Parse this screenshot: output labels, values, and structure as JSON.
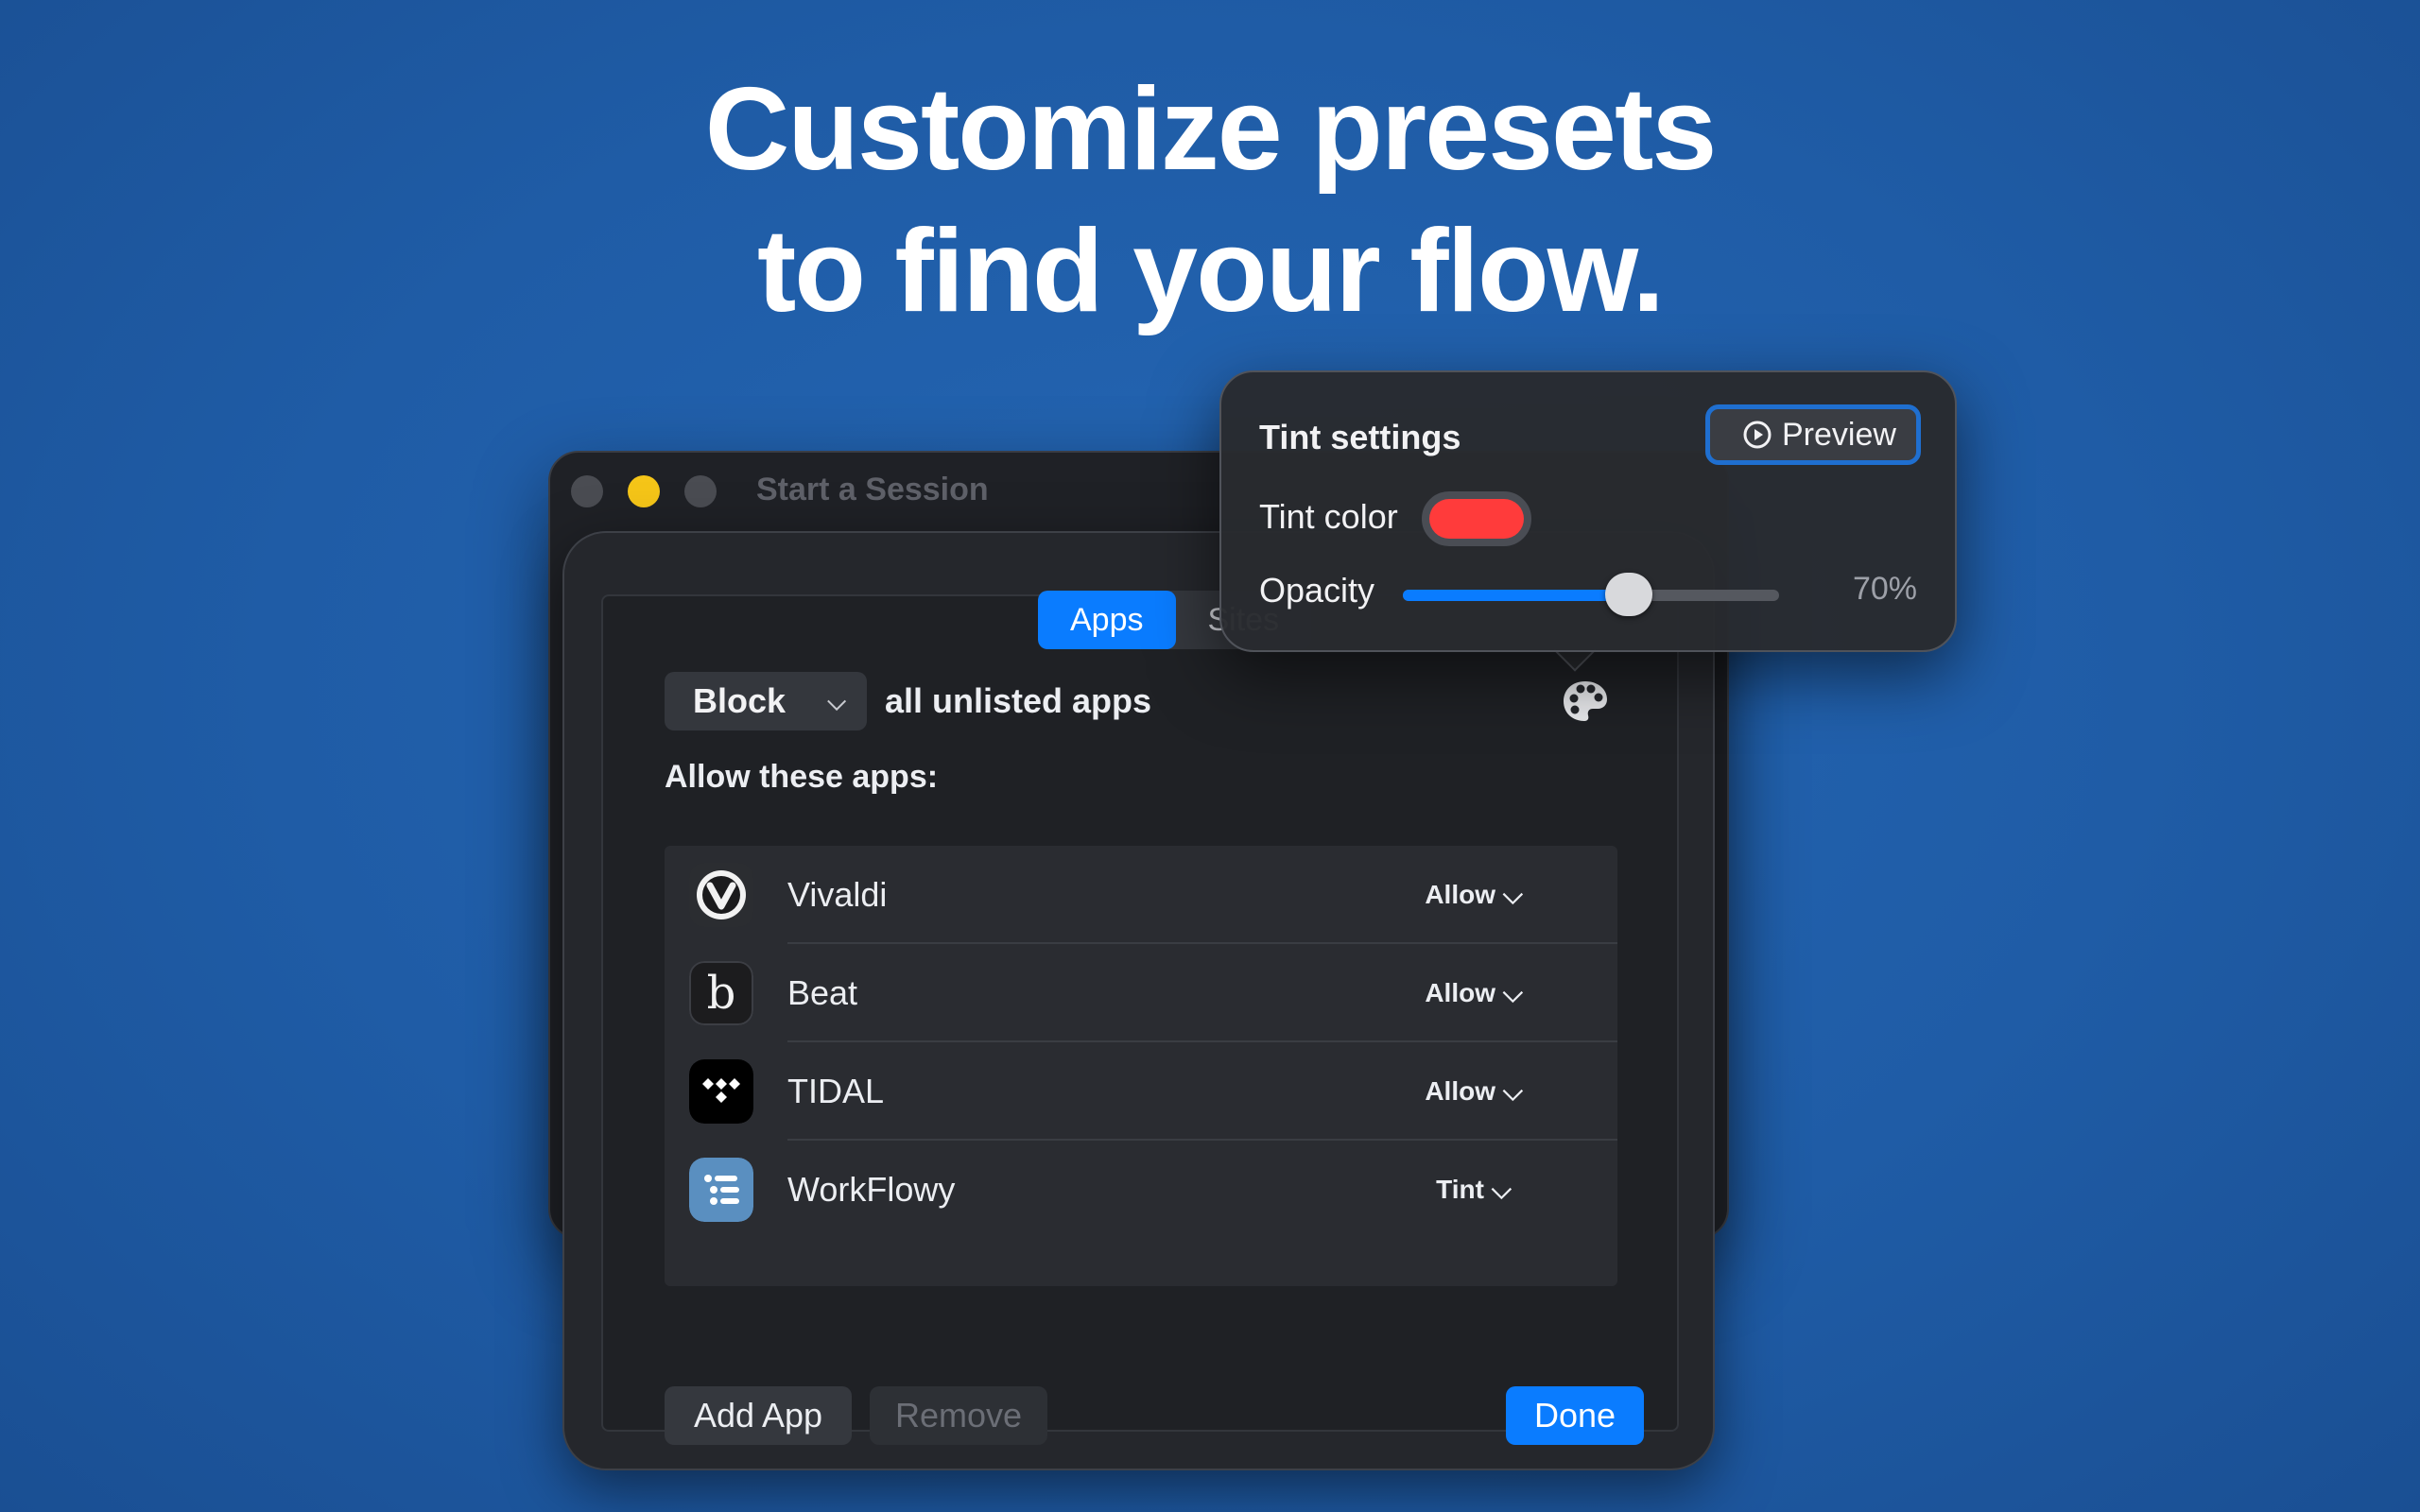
{
  "headline": {
    "line1": "Customize presets",
    "line2": "to find your flow."
  },
  "window": {
    "title": "Start a Session"
  },
  "tabs": [
    {
      "label": "Apps",
      "active": true
    },
    {
      "label": "Sites",
      "active": false
    }
  ],
  "mode": {
    "selected": "Block",
    "suffix": "all unlisted apps"
  },
  "allow_label": "Allow these apps:",
  "apps": [
    {
      "name": "Vivaldi",
      "action": "Allow",
      "icon": "vivaldi-icon"
    },
    {
      "name": "Beat",
      "action": "Allow",
      "icon": "beat-icon"
    },
    {
      "name": "TIDAL",
      "action": "Allow",
      "icon": "tidal-icon"
    },
    {
      "name": "WorkFlowy",
      "action": "Tint",
      "icon": "workflowy-icon"
    }
  ],
  "buttons": {
    "add": "Add App",
    "remove": "Remove",
    "done": "Done"
  },
  "tint": {
    "title": "Tint settings",
    "preview": "Preview",
    "color_label": "Tint color",
    "color": "#ff3b3b",
    "opacity_label": "Opacity",
    "opacity_value": "70%",
    "opacity": 0.6
  },
  "colors": {
    "background": "#1f5ca6",
    "accent": "#0a7cff"
  }
}
